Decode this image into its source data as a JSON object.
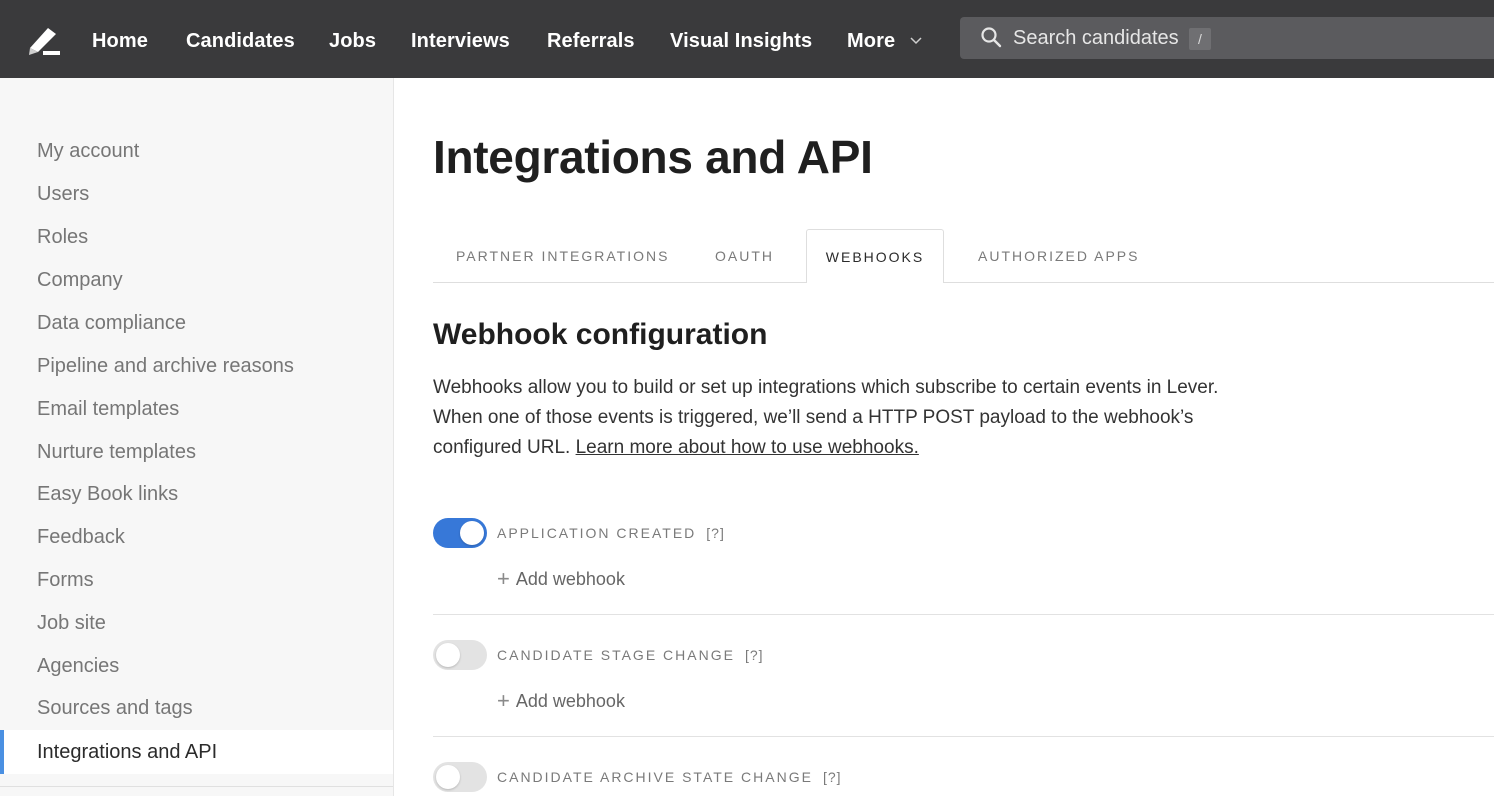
{
  "nav": {
    "items": [
      "Home",
      "Candidates",
      "Jobs",
      "Interviews",
      "Referrals",
      "Visual Insights",
      "More"
    ],
    "search_placeholder": "Search candidates",
    "search_shortcut": "/"
  },
  "sidebar": {
    "items": [
      "My account",
      "Users",
      "Roles",
      "Company",
      "Data compliance",
      "Pipeline and archive reasons",
      "Email templates",
      "Nurture templates",
      "Easy Book links",
      "Feedback",
      "Forms",
      "Job site",
      "Agencies",
      "Sources and tags"
    ],
    "active": "Integrations and API"
  },
  "main": {
    "title": "Integrations and API",
    "tabs": [
      "PARTNER INTEGRATIONS",
      "OAUTH",
      "WEBHOOKS",
      "AUTHORIZED APPS"
    ],
    "active_tab": "WEBHOOKS",
    "section_title": "Webhook configuration",
    "description": "Webhooks allow you to build or set up integrations which subscribe to certain events in Lever. When one of those events is triggered, we’ll send a HTTP POST payload to the webhook’s configured URL.",
    "learn_more": "Learn more about how to use webhooks.",
    "webhooks": [
      {
        "label": "APPLICATION CREATED",
        "help": "[?]",
        "enabled": true,
        "add_label": "Add webhook"
      },
      {
        "label": "CANDIDATE STAGE CHANGE",
        "help": "[?]",
        "enabled": false,
        "add_label": "Add webhook"
      },
      {
        "label": "CANDIDATE ARCHIVE STATE CHANGE",
        "help": "[?]",
        "enabled": false
      }
    ]
  },
  "colors": {
    "topbar": "#3a3a3c",
    "accent": "#3778d8",
    "sidebar_active": "#4a90e2"
  }
}
